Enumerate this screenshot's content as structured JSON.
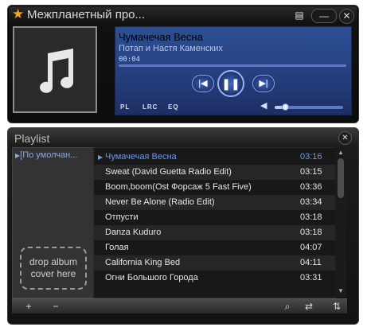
{
  "app": {
    "title": "Межпланетный про...",
    "colors": {
      "accent": "#f7a21b",
      "screen": "#284487",
      "active_track": "#6d98f0"
    }
  },
  "player": {
    "song_title": "Чумачечая Весна",
    "artist": "Потап и Настя Каменских",
    "time": "00:04",
    "progress": 0.0,
    "volume": 0.15,
    "modes": [
      "PL",
      "LRC",
      "EQ"
    ],
    "controls": {
      "prev": "|◀",
      "play_pause": "❚❚",
      "next": "▶|"
    }
  },
  "playlist": {
    "title": "Playlist",
    "list_name": "[По умолчан...",
    "drop_zone": "drop album cover here",
    "tracks": [
      {
        "title": "Чумачечая Весна",
        "duration": "03:16",
        "active": true
      },
      {
        "title": "Sweat (David Guetta Radio Edit)",
        "duration": "03:15"
      },
      {
        "title": "Boom,boom(Ost Форсаж 5 Fast Five)",
        "duration": "03:36"
      },
      {
        "title": "Never Be Alone (Radio Edit)",
        "duration": "03:34"
      },
      {
        "title": "Отпусти",
        "duration": "03:18"
      },
      {
        "title": "Danza Kuduro",
        "duration": "03:18"
      },
      {
        "title": "Голая",
        "duration": "04:07"
      },
      {
        "title": "California King Bed",
        "duration": "04:11"
      },
      {
        "title": "Огни Большого Города",
        "duration": "03:31"
      }
    ],
    "toolbar": {
      "add": "+",
      "remove": "−",
      "search": "⌕",
      "repeat": "⇄",
      "sort": "⇅"
    }
  }
}
